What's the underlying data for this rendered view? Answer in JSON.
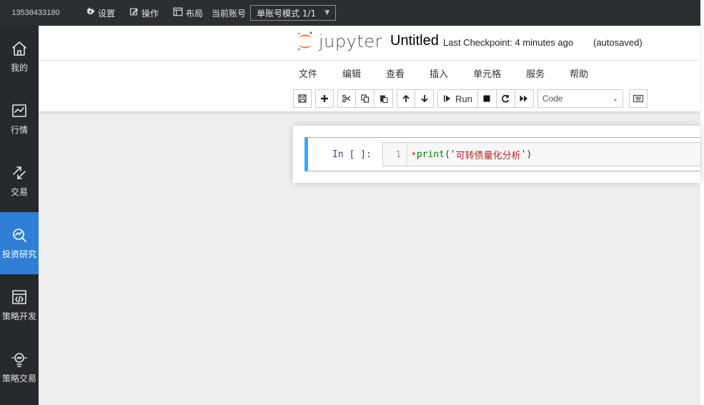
{
  "topbar": {
    "account": "13538433180",
    "items": [
      {
        "label": "设置",
        "icon": "gear-icon"
      },
      {
        "label": "操作",
        "icon": "edit-icon"
      },
      {
        "label": "布局",
        "icon": "layout-icon"
      }
    ],
    "current_account_label": "当前账号",
    "mode_value": "单账号模式 1/1"
  },
  "sidebar": {
    "items": [
      {
        "label": "我的",
        "icon": "home-icon",
        "active": false
      },
      {
        "label": "行情",
        "icon": "market-chart-icon",
        "active": false
      },
      {
        "label": "交易",
        "icon": "trade-arrows-icon",
        "active": false
      },
      {
        "label": "投资研究",
        "icon": "research-icon",
        "active": true
      },
      {
        "label": "策略开发",
        "icon": "code-window-icon",
        "active": false
      },
      {
        "label": "策略交易",
        "icon": "bulb-icon",
        "active": false
      }
    ],
    "active_color": "#2f7fd4"
  },
  "jupyter": {
    "logo_text": "jupyter",
    "notebook_name": "Untitled",
    "checkpoint": "Last Checkpoint: 4 minutes ago",
    "autosave": "(autosaved)",
    "menu": [
      "文件",
      "编辑",
      "查看",
      "插入",
      "单元格",
      "服务",
      "帮助"
    ],
    "toolbar": {
      "run_label": "Run",
      "cell_type": "Code"
    },
    "cell": {
      "prompt": "In [ ]:",
      "line_number": "1",
      "code_keyword": "print",
      "code_open": "('",
      "code_string": "可转债量化分析",
      "code_close": "')"
    },
    "cell_accent_color": "#42a5f5"
  }
}
